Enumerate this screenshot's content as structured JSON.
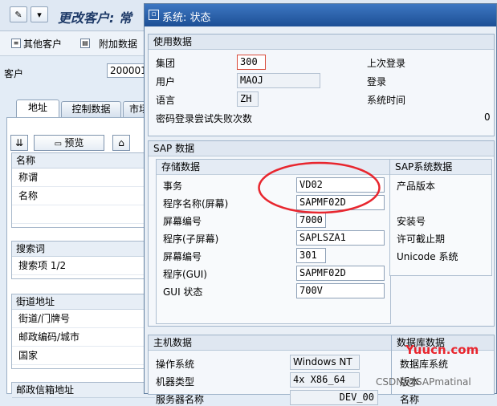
{
  "background_window": {
    "title": "更改客户: 常",
    "toolbar": {
      "other_customer": "其他客户",
      "additional_data": "附加数据"
    },
    "customer": {
      "label": "客户",
      "value": "200001"
    },
    "tabs": [
      {
        "label": "地址",
        "active": true
      },
      {
        "label": "控制数据",
        "active": false
      },
      {
        "label": "市场",
        "active": false
      }
    ],
    "preview_button": "预览",
    "groups": {
      "name": {
        "title": "名称",
        "rows": [
          "称谓",
          "名称"
        ]
      },
      "search": {
        "title": "搜索词",
        "rows": [
          "搜索项 1/2"
        ]
      },
      "street": {
        "title": "街道地址",
        "rows": [
          "街道/门牌号",
          "邮政编码/城市",
          "国家"
        ]
      },
      "pobox": {
        "title": "邮政信箱地址"
      }
    }
  },
  "dialog": {
    "title": "系统: 状态",
    "usage_data": {
      "title": "使用数据",
      "client_label": "集团",
      "client_value": "300",
      "user_label": "用户",
      "user_value": "MAOJ",
      "language_label": "语言",
      "language_value": "ZH",
      "failed_logons_label": "密码登录尝试失败次数",
      "failed_logons_value": "0",
      "last_logon_label": "上次登录",
      "logon_label": "登录",
      "system_time_label": "系统时间"
    },
    "sap_data": {
      "title": "SAP 数据",
      "repository": {
        "title": "存储数据",
        "rows": [
          {
            "label": "事务",
            "value": "VD02"
          },
          {
            "label": "程序名称(屏幕)",
            "value": "SAPMF02D"
          },
          {
            "label": "屏幕编号",
            "value": "7000"
          },
          {
            "label": "程序(子屏幕)",
            "value": "SAPLSZA1"
          },
          {
            "label": "屏幕编号",
            "value": "301"
          },
          {
            "label": "程序(GUI)",
            "value": "SAPMF02D"
          },
          {
            "label": "GUI 状态",
            "value": "700V"
          }
        ]
      },
      "system_data": {
        "title": "SAP系统数据",
        "product_version_label": "产品版本",
        "install_no_label": "安装号",
        "license_expiry_label": "许可截止期",
        "unicode_label": "Unicode 系统"
      }
    },
    "host_data": {
      "title": "主机数据",
      "os_label": "操作系统",
      "os_value": "Windows NT",
      "machine_label": "机器类型",
      "machine_value": "4x X86_64",
      "server_label": "服务器名称",
      "server_value": "DEV_00"
    },
    "database_data": {
      "title": "数据库数据",
      "db_system_label": "数据库系统",
      "release_label": "版本",
      "name_label": "名称"
    }
  },
  "watermarks": {
    "site": "Yuucn.com",
    "credit": "CSDN @SAPmatinal"
  },
  "colors": {
    "annotation_circle": "#e8262e",
    "title_bar": "#1d4f95"
  }
}
